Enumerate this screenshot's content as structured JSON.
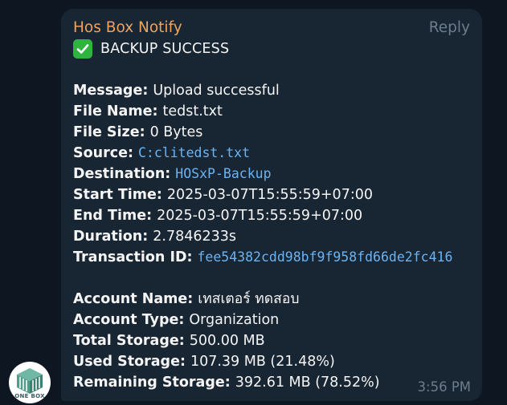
{
  "message": {
    "sender": "Hos Box Notify",
    "reply_label": "Reply",
    "title": "BACKUP SUCCESS",
    "time": "3:56 PM",
    "details": [
      {
        "key": "Message:",
        "value": "Upload successful",
        "code": false
      },
      {
        "key": "File Name:",
        "value": "tedst.txt",
        "code": false
      },
      {
        "key": "File Size:",
        "value": "0 Bytes",
        "code": false
      },
      {
        "key": "Source:",
        "value": "C:clitedst.txt",
        "code": true
      },
      {
        "key": "Destination:",
        "value": "HOSxP-Backup",
        "code": true
      },
      {
        "key": "Start Time:",
        "value": "2025-03-07T15:55:59+07:00",
        "code": false
      },
      {
        "key": "End Time:",
        "value": "2025-03-07T15:55:59+07:00",
        "code": false
      },
      {
        "key": "Duration:",
        "value": "2.7846233s",
        "code": false
      },
      {
        "key": "Transaction ID:",
        "value": "fee54382cdd98bf9f958fd66de2fc416",
        "code": true
      }
    ],
    "account": [
      {
        "key": "Account Name:",
        "value": "เทสเตอร์ ทดสอบ"
      },
      {
        "key": "Account Type:",
        "value": "Organization"
      },
      {
        "key": "Total Storage:",
        "value": "500.00 MB"
      },
      {
        "key": "Used Storage:",
        "value": "107.39 MB (21.48%)"
      },
      {
        "key": "Remaining Storage:",
        "value": "392.61 MB (78.52%)"
      }
    ]
  },
  "avatar": {
    "label": "ONE BOX",
    "icon": "one-box-logo-icon"
  },
  "colors": {
    "background": "#0e1621",
    "bubble": "#182533",
    "sender": "#f0a35e",
    "muted": "#6b7d8e",
    "code": "#6ab3f3",
    "check": "#2fb53f"
  }
}
